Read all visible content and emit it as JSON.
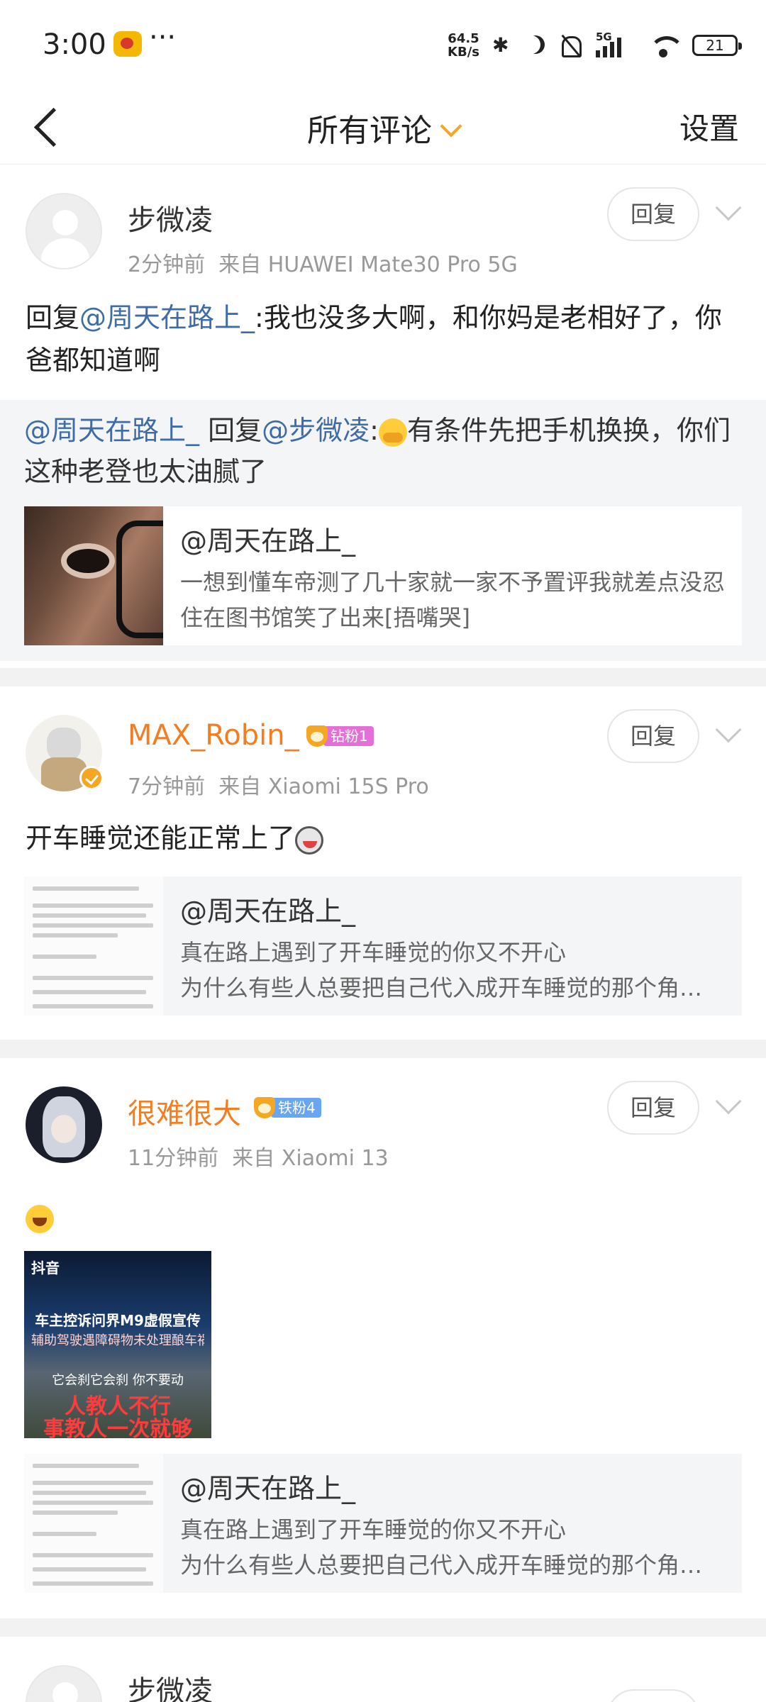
{
  "status_bar": {
    "time": "3:00",
    "more": "···",
    "net_speed_value": "64.5",
    "net_speed_unit": "KB/s",
    "network": "5G",
    "battery": "21"
  },
  "header": {
    "title": "所有评论",
    "settings": "设置"
  },
  "comments": [
    {
      "username": "步微凌",
      "time": "2分钟前",
      "source": "来自 HUAWEI Mate30 Pro 5G",
      "reply_label": "回复",
      "text_prefix": "回复",
      "mention": "@周天在路上_",
      "text_suffix": ":我也没多大啊，和你妈是老相好了，你爸都知道啊",
      "sub_reply": {
        "mention1": "@周天在路上_",
        "mid": " 回复",
        "mention2": "@步微凌",
        "colon": ":",
        "text": "有条件先把手机换换，你们这种老登也太油腻了"
      },
      "card": {
        "title": "@周天在路上_",
        "body": "一想到懂车帝测了几十家就一家不予置评我就差点没忍住在图书馆笑了出来[捂嘴哭]"
      }
    },
    {
      "username": "MAX_Robin_",
      "fan_badge": "钻粉1",
      "time": "7分钟前",
      "source": "来自 Xiaomi 15S Pro",
      "reply_label": "回复",
      "text": "开车睡觉还能正常上了",
      "card": {
        "title": "@周天在路上_",
        "line1": "真在路上遇到了开车睡觉的你又不开心",
        "line2": "为什么有些人总要把自己代入成开车睡觉的那个角…"
      }
    },
    {
      "username": "很难很大",
      "fan_badge": "铁粉4",
      "time": "11分钟前",
      "source": "来自 Xiaomi 13",
      "reply_label": "回复",
      "video": {
        "app": "抖音",
        "line1": "车主控诉问界M9虚假宣传",
        "line2": "辅助驾驶遇障碍物未处理酿车祸",
        "line3": "它会刹它会刹 你不要动",
        "line4": "人教人不行",
        "line5": "事教人一次就够"
      },
      "card": {
        "title": "@周天在路上_",
        "line1": "真在路上遇到了开车睡觉的你又不开心",
        "line2": "为什么有些人总要把自己代入成开车睡觉的那个角…"
      }
    },
    {
      "username": "步微凌"
    }
  ]
}
